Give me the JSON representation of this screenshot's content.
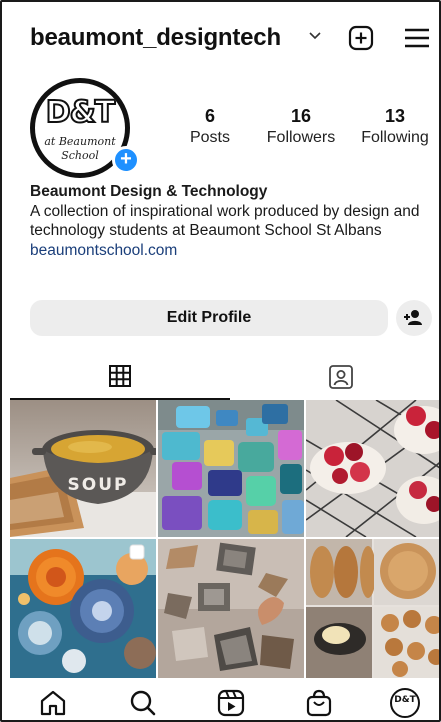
{
  "header": {
    "username": "beaumont_designtech",
    "username_dropdown_icon": "chevron-down-icon",
    "new_post_icon": "plus-square-icon",
    "menu_icon": "hamburger-menu-icon"
  },
  "profile": {
    "avatar": {
      "logo_text": "D&T",
      "logo_line1": "at Beaumont",
      "logo_line2": "School",
      "add_story_badge": "+"
    },
    "stats": [
      {
        "value": "6",
        "label": "Posts"
      },
      {
        "value": "16",
        "label": "Followers"
      },
      {
        "value": "13",
        "label": "Following"
      }
    ],
    "bio": {
      "name": "Beaumont Design & Technology",
      "description": "A collection of inspirational work produced by design and technology students at Beaumont School St Albans",
      "link": "beaumontschool.com"
    }
  },
  "actions": {
    "edit_profile_label": "Edit Profile",
    "add_user_icon": "add-person-icon"
  },
  "tabs": [
    {
      "name": "grid",
      "icon": "grid-icon",
      "active": true
    },
    {
      "name": "tagged",
      "icon": "tagged-person-icon",
      "active": false
    }
  ],
  "posts": [
    {
      "subject": "soup bowl with bread",
      "bowl_text": "SOUP"
    },
    {
      "subject": "resin pieces"
    },
    {
      "subject": "meringues with strawberries"
    },
    {
      "subject": "textile sea urchins",
      "multi_image": true
    },
    {
      "subject": "pewter castings"
    },
    {
      "subject": "baked bread collage"
    }
  ],
  "bottom_nav": [
    {
      "name": "home",
      "icon": "home-icon"
    },
    {
      "name": "search",
      "icon": "search-icon"
    },
    {
      "name": "reels",
      "icon": "reels-icon"
    },
    {
      "name": "shop",
      "icon": "shop-bag-icon"
    },
    {
      "name": "profile",
      "icon": "profile-avatar-icon",
      "avatar_text": "D&T"
    }
  ],
  "colors": {
    "accent_blue": "#1e90ff",
    "link": "#1a3e7a",
    "button_bg": "#ededed",
    "text": "#111111"
  }
}
